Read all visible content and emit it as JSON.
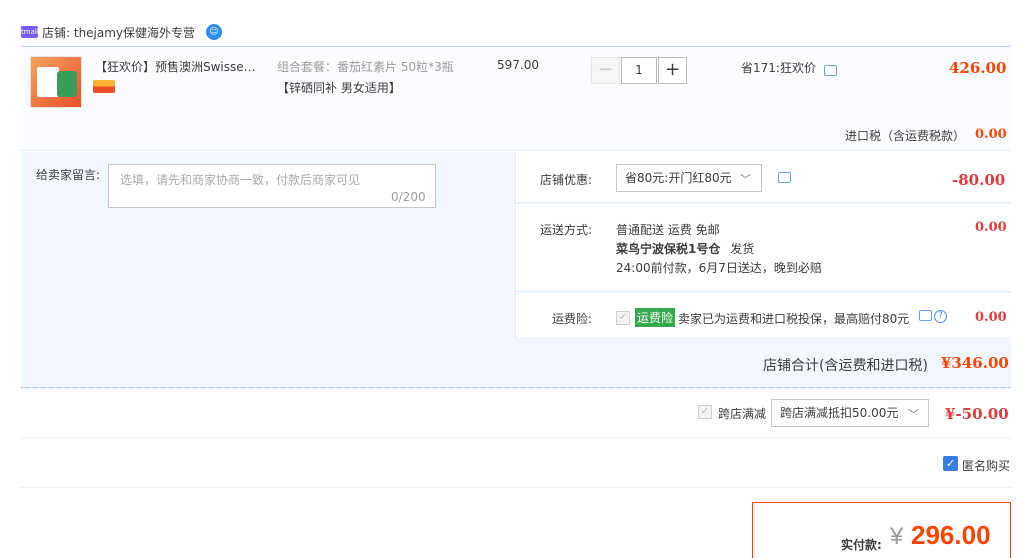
{
  "shop": {
    "icon_text": "tmall",
    "line": "店铺: thejamy保健海外专营"
  },
  "item": {
    "title": "【狂欢价】预售澳洲Swisse斯…",
    "sku_line1": "组合套餐：番茄红素片 50粒*3瓶",
    "sku_line2": "【锌硒同补 男女适用】",
    "unit_price": "597.00",
    "quantity": "1",
    "minus": "−",
    "plus": "+",
    "saving": "省171:狂欢价",
    "total": "426.00"
  },
  "tax": {
    "label": "进口税（含运费税款）",
    "value": "0.00"
  },
  "message": {
    "label": "给卖家留言:",
    "placeholder": "选填，请先和商家协商一致，付款后商家可见",
    "count": "0/200"
  },
  "promo": {
    "label": "店铺优惠:",
    "selected": "省80元:开门红80元",
    "value": "-80.00"
  },
  "shipping": {
    "label": "运送方式:",
    "line1": "普通配送 运费 免邮",
    "line2_bold": "菜鸟宁波保税1号仓",
    "line2_rest": "发货",
    "line3": "24:00前付款，6月7日送达，晚到必赔",
    "value": "0.00"
  },
  "insurance": {
    "label": "运费险:",
    "badge": "运费险",
    "text": "卖家已为运费和进口税投保，最高赔付80元",
    "value": "0.00"
  },
  "shop_total": {
    "label": "店铺合计(含运费和进口税)",
    "value": "¥346.00"
  },
  "cross_shop": {
    "label": "跨店满减",
    "selected": "跨店满减抵扣50.00元",
    "value": "¥-50.00"
  },
  "anonymous": {
    "label": "匿名购买",
    "checked": true
  },
  "final": {
    "label": "实付款:",
    "currency": "¥",
    "value": "296.00"
  },
  "colors": {
    "accent": "#ff4400",
    "border_blue": "#b2d1ff",
    "band_bg": "#f2f7ff",
    "check_blue": "#3a7de0",
    "badge_green": "#35a84d"
  }
}
